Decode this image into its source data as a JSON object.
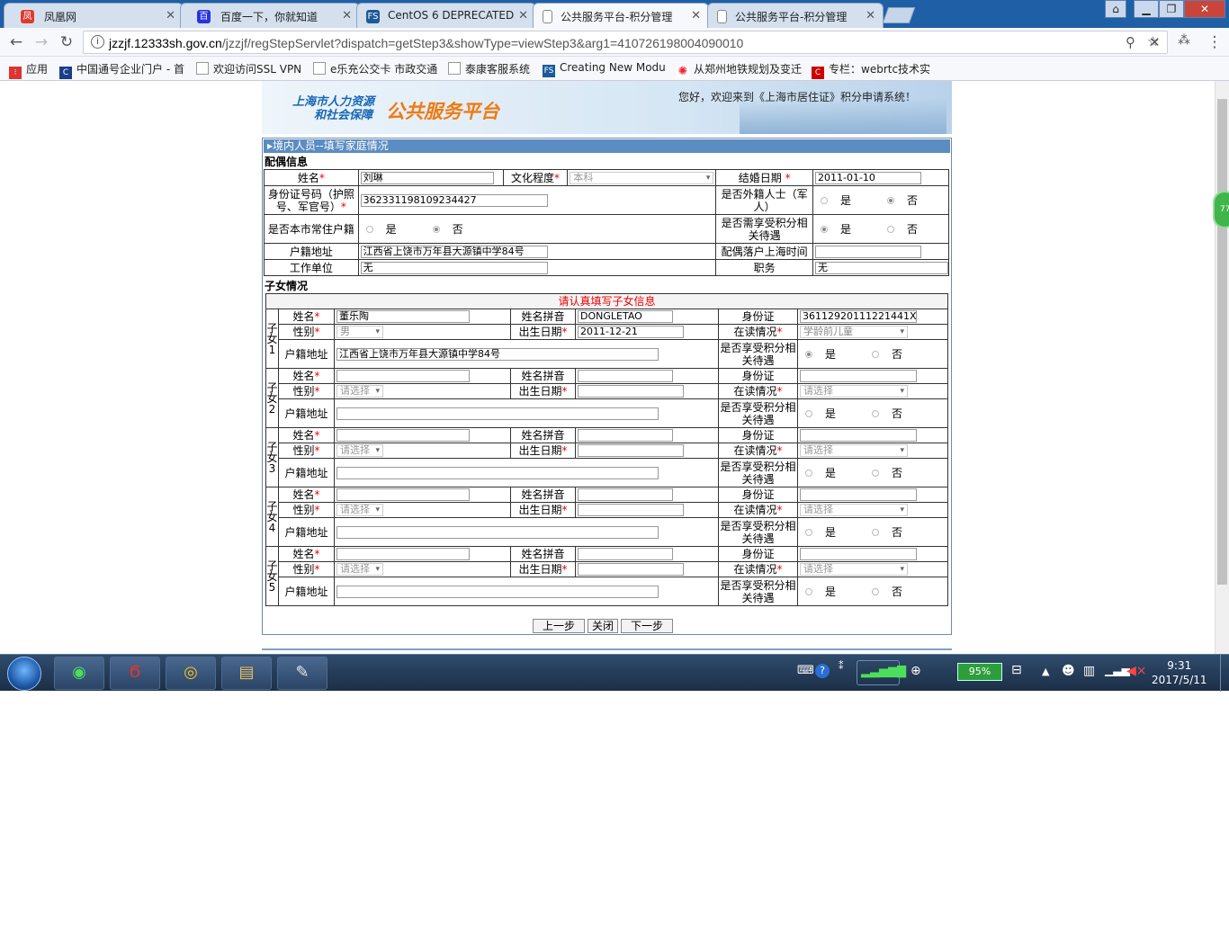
{
  "browser": {
    "tabs": [
      {
        "label": "凤凰网",
        "icon": "phoenix-icon",
        "color": "#e03a2f"
      },
      {
        "label": "百度一下，你就知道",
        "icon": "baidu-paw-icon",
        "color": "#2b32e1"
      },
      {
        "label": "CentOS 6 DEPRECATED",
        "icon": "fs-icon",
        "color": "#1a5a9a"
      },
      {
        "label": "公共服务平台-积分管理",
        "icon": "page-icon",
        "color": "#888"
      },
      {
        "label": "公共服务平台-积分管理",
        "icon": "page-icon",
        "color": "#888"
      }
    ],
    "url_host": "jzzjf.12333sh.gov.cn",
    "url_path": "/jzzjf/regStepServlet?dispatch=getStep3&showType=viewStep3&arg1=410726198004090010",
    "bookmarks": [
      {
        "label": "应用",
        "icon": "apps-icon",
        "color": "#d33"
      },
      {
        "label": "中国通号企业门户 - 首",
        "icon": "crsc-icon",
        "color": "#1a3f8a"
      },
      {
        "label": "欢迎访问SSL VPN",
        "icon": "page-icon",
        "color": "#999"
      },
      {
        "label": "e乐充公交卡 市政交通",
        "icon": "page-icon",
        "color": "#999"
      },
      {
        "label": "泰康客服系统",
        "icon": "page-icon",
        "color": "#999"
      },
      {
        "label": "Creating New Modu",
        "icon": "fs-icon",
        "color": "#1a5a9a"
      },
      {
        "label": "从郑州地铁规划及变迁",
        "icon": "sunflower-icon",
        "color": "#e23"
      },
      {
        "label": "专栏：webrtc技术实",
        "icon": "csdn-icon",
        "color": "#c00"
      }
    ]
  },
  "banner": {
    "org_line1": "上海市人力资源",
    "org_line2": "和社会保障",
    "platform": "公共服务平台",
    "welcome": "您好，欢迎来到《上海市居住证》积分申请系统！",
    "badge": "77"
  },
  "form": {
    "section_title": "境内人员--填写家庭情况",
    "spouse_heading": "配偶信息",
    "spouse": {
      "name_label": "姓名",
      "name": "刘琳",
      "edu_label": "文化程度",
      "edu": "本科",
      "marry_label": "结婚日期",
      "marry": "2011-01-10",
      "id_label": "身份证号码（护照号、军官号）",
      "id": "362331198109234427",
      "foreign_label": "是否外籍人士（军人）",
      "yes": "是",
      "no": "否",
      "resident_label": "是否本市常住户籍",
      "benefit_label": "是否需享受积分相关待遇",
      "hukou_label": "户籍地址",
      "hukou": "江西省上饶市万年县大源镇中学84号",
      "settle_label": "配偶落户上海时间",
      "settle": "",
      "work_label": "工作单位",
      "work": "无",
      "duty_label": "职务",
      "duty": "无"
    },
    "children_heading": "子女情况",
    "children_notice": "请认真填写子女信息",
    "labels": {
      "name": "姓名",
      "pinyin": "姓名拼音",
      "id": "身份证",
      "gender": "性别",
      "birth": "出生日期",
      "school": "在读情况",
      "hukou": "户籍地址",
      "benefit": "是否享受积分相关待遇",
      "yes": "是",
      "no": "否"
    },
    "children": [
      {
        "tag": "子女1",
        "name": "董乐陶",
        "pinyin": "DONGLETAO",
        "id": "36112920111221441X",
        "gender": "男",
        "birth": "2011-12-21",
        "school": "学龄前儿童",
        "hukou": "江西省上饶市万年县大源镇中学84号",
        "benefit": "yes"
      },
      {
        "tag": "子女2",
        "name": "",
        "pinyin": "",
        "id": "",
        "gender": "请选择",
        "birth": "",
        "school": "请选择",
        "hukou": "",
        "benefit": "none"
      },
      {
        "tag": "子女3",
        "name": "",
        "pinyin": "",
        "id": "",
        "gender": "请选择",
        "birth": "",
        "school": "请选择",
        "hukou": "",
        "benefit": "none"
      },
      {
        "tag": "子女4",
        "name": "",
        "pinyin": "",
        "id": "",
        "gender": "请选择",
        "birth": "",
        "school": "请选择",
        "hukou": "",
        "benefit": "none"
      },
      {
        "tag": "子女5",
        "name": "",
        "pinyin": "",
        "id": "",
        "gender": "请选择",
        "birth": "",
        "school": "请选择",
        "hukou": "",
        "benefit": "none"
      }
    ],
    "buttons": {
      "prev": "上一步",
      "close": "关闭",
      "next": "下一步"
    }
  },
  "taskbar": {
    "battery": "95%",
    "time": "9:31",
    "date": "2017/5/11"
  }
}
